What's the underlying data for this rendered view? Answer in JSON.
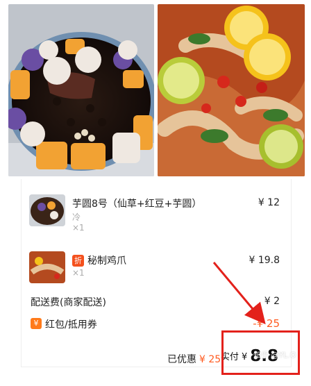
{
  "order": {
    "items": [
      {
        "name": "芋圆8号（仙草+红豆+芋圆）",
        "spec": "冷",
        "qty": "×1",
        "price": "¥ 12"
      },
      {
        "badge": "折",
        "name": "秘制鸡爪",
        "qty": "×1",
        "price": "¥ 19.8"
      }
    ],
    "delivery": {
      "label": "配送费(商家配送)",
      "price": "¥ 2"
    },
    "coupon": {
      "icon_text": "¥",
      "label": "红包/抵用券",
      "amount": "-¥ 25"
    },
    "summary": {
      "saved_label": "已优惠",
      "saved_amount": "¥ 25",
      "paid_label": "实付 ¥",
      "paid_amount": "8.8"
    }
  },
  "watermark": "知乎 @YL.O",
  "colors": {
    "accent_orange": "#ff5a1f",
    "highlight_red": "#e3211b",
    "badge_orange": "#f4511e"
  },
  "icons": {
    "coupon": "yen-coupon-icon",
    "discount_badge": "zhe-badge"
  }
}
